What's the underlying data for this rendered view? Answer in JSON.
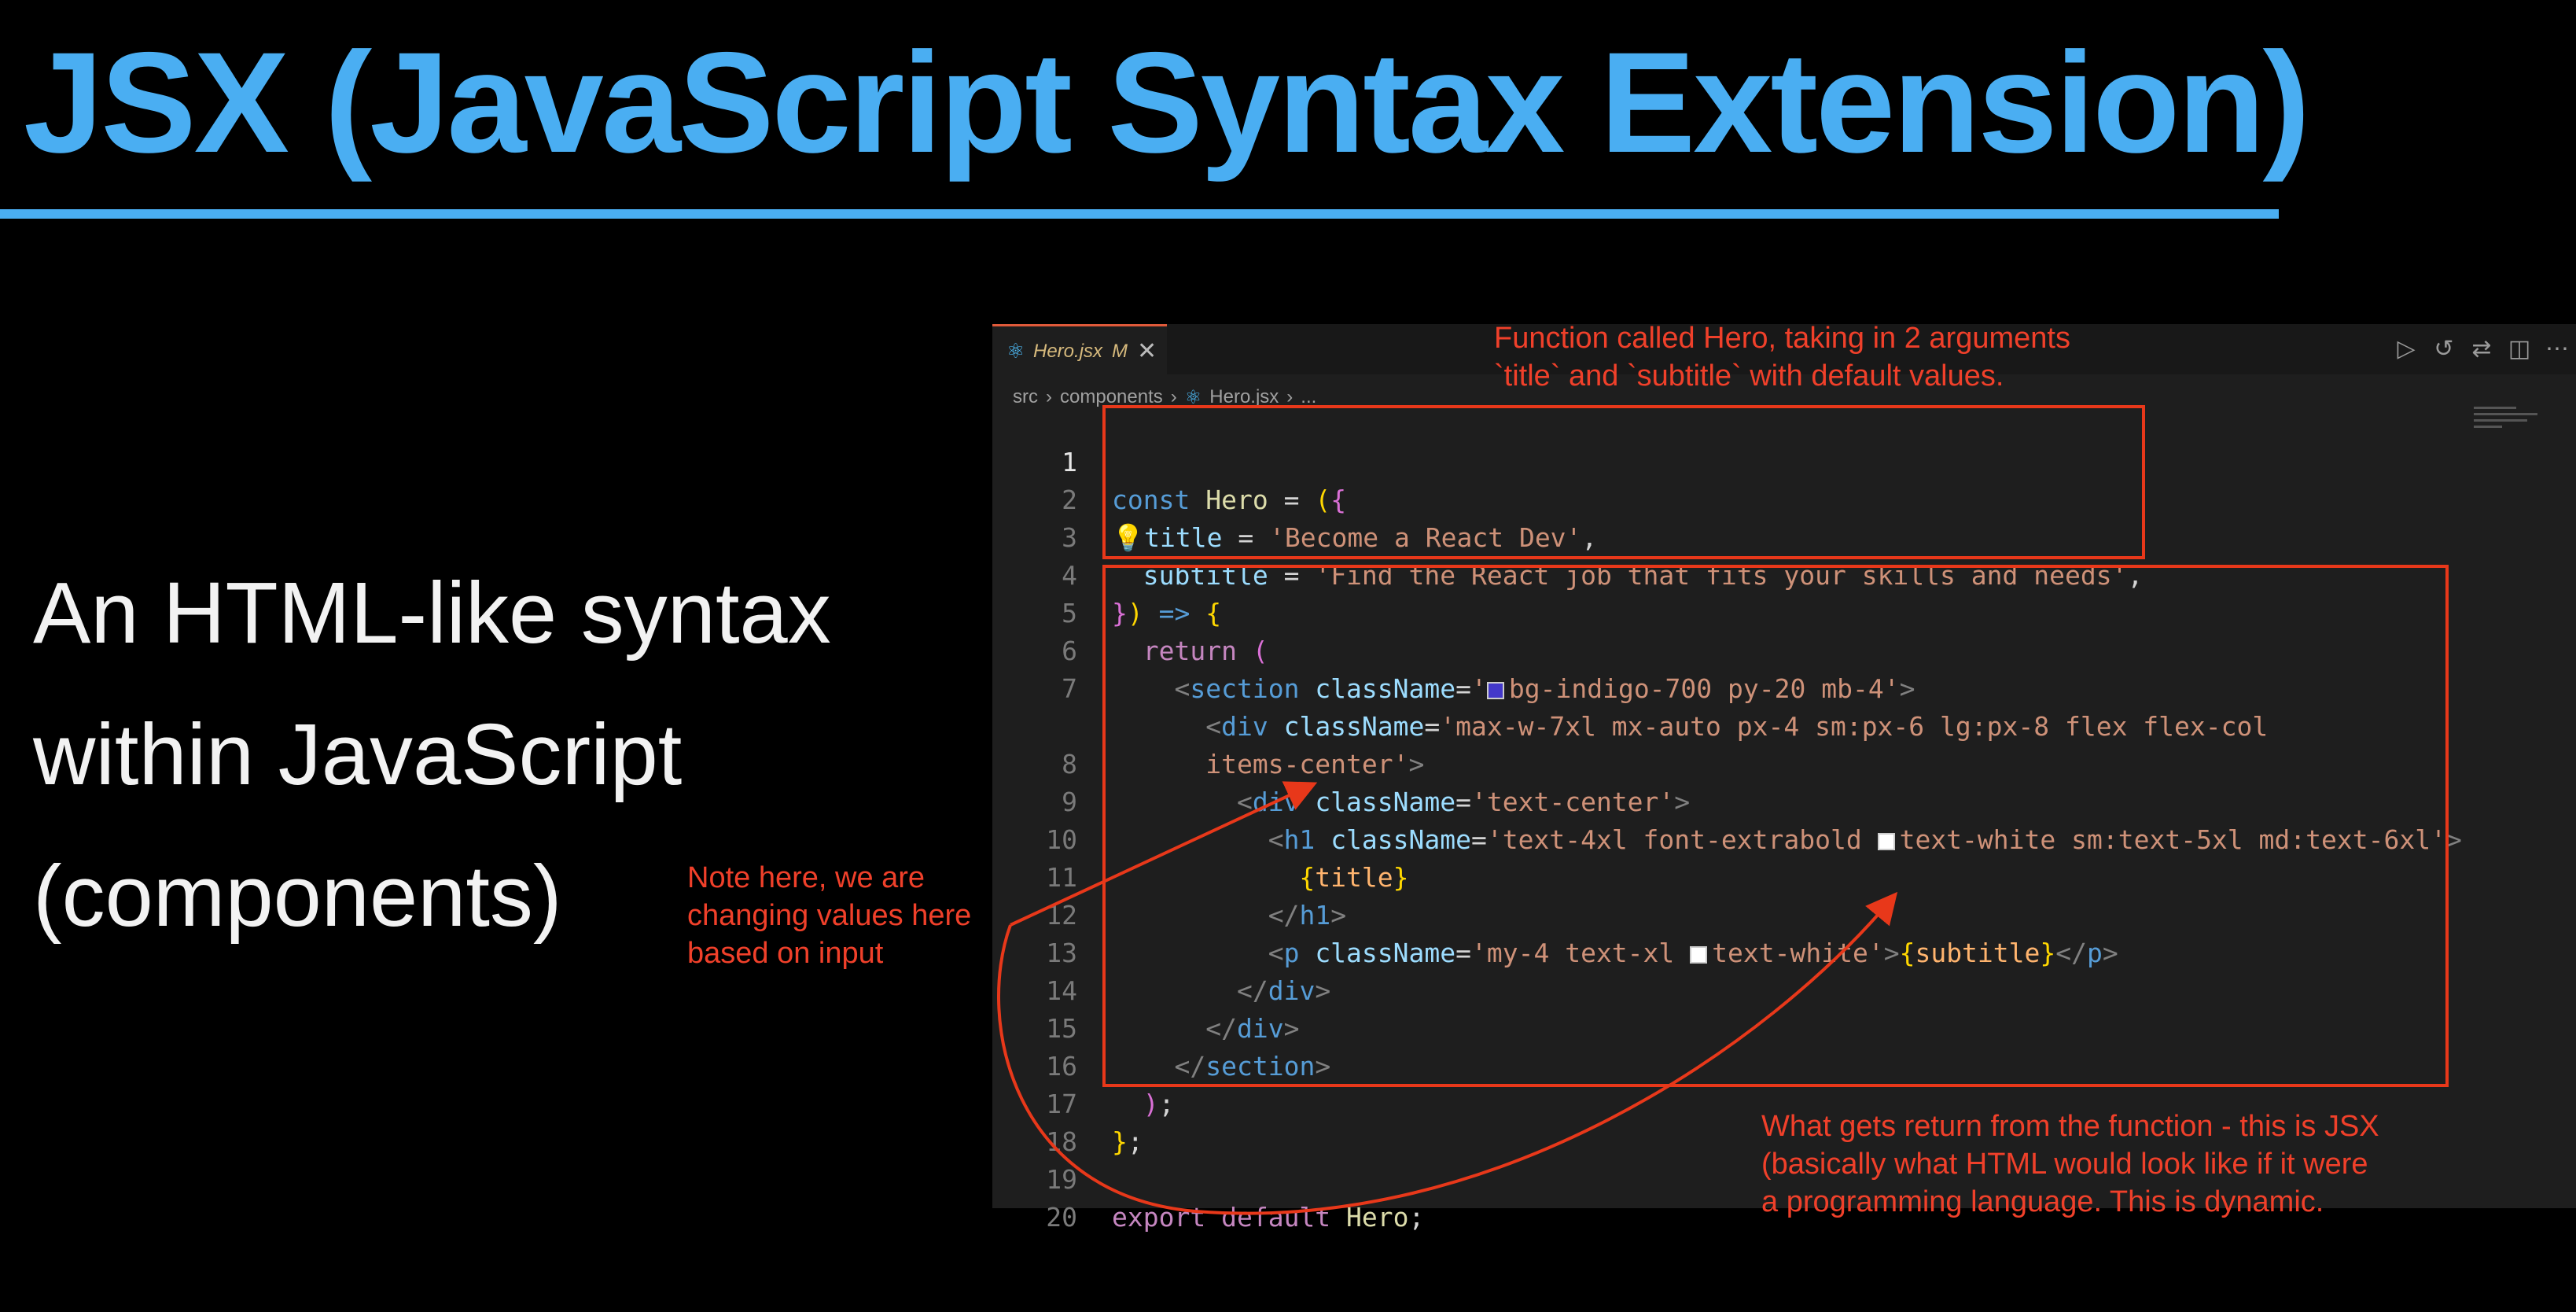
{
  "slide": {
    "title": "JSX (JavaScript Syntax Extension)",
    "subtitle_lines": [
      "An HTML-like syntax",
      "within JavaScript",
      "(components)"
    ]
  },
  "editor": {
    "tab": {
      "filename": "Hero.jsx",
      "status": "M",
      "close": "✕",
      "icon": "react-icon"
    },
    "toolbar_icons": [
      "run-icon",
      "history-icon",
      "compare-icon",
      "split-editor-icon",
      "more-icon"
    ],
    "breadcrumb": [
      "src",
      "components",
      "Hero.jsx",
      "..."
    ],
    "active_line": 1,
    "lines": [
      {
        "n": "1",
        "text": "const Hero = ({"
      },
      {
        "n": "2",
        "text": "title = 'Become a React Dev',"
      },
      {
        "n": "3",
        "text": "subtitle = 'Find the React job that fits your skills and needs',"
      },
      {
        "n": "4",
        "text": "}) => {"
      },
      {
        "n": "5",
        "text": "return ("
      },
      {
        "n": "6",
        "text": "<section className='bg-indigo-700 py-20 mb-4'>"
      },
      {
        "n": "7",
        "text": "<div className='max-w-7xl mx-auto px-4 sm:px-6 lg:px-8 flex flex-col"
      },
      {
        "n": "",
        "text": "items-center'>"
      },
      {
        "n": "8",
        "text": "<div className='text-center'>"
      },
      {
        "n": "9",
        "text": "<h1 className='text-4xl font-extrabold text-white sm:text-5xl md:text-6xl'>"
      },
      {
        "n": "10",
        "text": "{title}"
      },
      {
        "n": "11",
        "text": "</h1>"
      },
      {
        "n": "12",
        "text": "<p className='my-4 text-xl text-white'>{subtitle}</p>"
      },
      {
        "n": "13",
        "text": "</div>"
      },
      {
        "n": "14",
        "text": "</div>"
      },
      {
        "n": "15",
        "text": "</section>"
      },
      {
        "n": "16",
        "text": ");"
      },
      {
        "n": "17",
        "text": "};"
      },
      {
        "n": "18",
        "text": ""
      },
      {
        "n": "19",
        "text": "export default Hero;"
      },
      {
        "n": "20",
        "text": ""
      }
    ]
  },
  "annotations": {
    "top": [
      "Function called Hero, taking in 2 arguments",
      "`title` and `subtitle` with default values."
    ],
    "left": [
      "Note here, we are",
      "changing values here",
      "based on input"
    ],
    "bottom": [
      "What gets return from the function - this is JSX",
      "(basically what HTML would look like if it were",
      "a programming language. This is dynamic."
    ]
  },
  "colors": {
    "title": "#4aaef2",
    "annotation": "#f0402a",
    "indigo_swatch": "#4338ca",
    "white_swatch": "#ffffff"
  }
}
